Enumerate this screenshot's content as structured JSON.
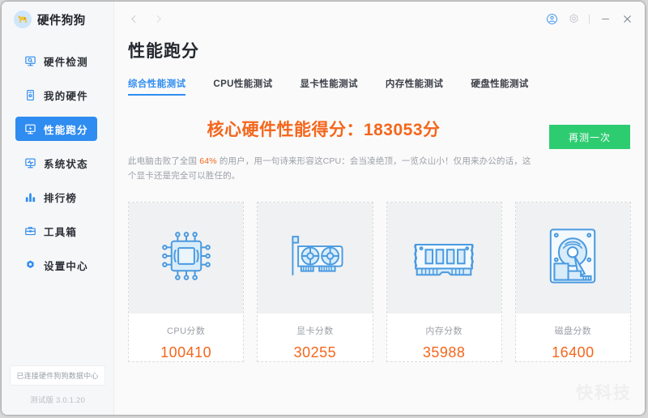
{
  "app": {
    "logo_icon": "dog-icon",
    "name": "硬件狗狗"
  },
  "sidebar": {
    "items": [
      {
        "label": "硬件检测",
        "icon": "monitor-search-icon",
        "active": false
      },
      {
        "label": "我的硬件",
        "icon": "desktop-tower-icon",
        "active": false
      },
      {
        "label": "性能跑分",
        "icon": "monitor-bolt-icon",
        "active": true
      },
      {
        "label": "系统状态",
        "icon": "monitor-pulse-icon",
        "active": false
      },
      {
        "label": "排行榜",
        "icon": "bar-chart-icon",
        "active": false
      },
      {
        "label": "工具箱",
        "icon": "toolbox-icon",
        "active": false
      },
      {
        "label": "设置中心",
        "icon": "gear-icon",
        "active": false
      }
    ],
    "status": "已连接硬件狗狗数据中心",
    "version": "测试版 3.0.1.20"
  },
  "titlebar": {
    "back_icon": "chevron-left-icon",
    "forward_icon": "chevron-right-icon",
    "account_icon": "user-avatar-icon",
    "settings_icon": "gear-icon",
    "minimize_icon": "minimize-icon",
    "close_icon": "close-icon"
  },
  "main": {
    "page_title": "性能跑分",
    "tabs": [
      {
        "label": "综合性能测试",
        "active": true
      },
      {
        "label": "CPU性能测试",
        "active": false
      },
      {
        "label": "显卡性能测试",
        "active": false
      },
      {
        "label": "内存性能测试",
        "active": false
      },
      {
        "label": "硬盘性能测试",
        "active": false
      }
    ],
    "score_headline": "核心硬件性能得分：183053分",
    "score_total": "183053",
    "desc_before": "此电脑击败了全国 ",
    "desc_percent": "64%",
    "desc_after": " 的用户，用一句诗来形容这CPU：会当凌绝顶，一览众山小！仅用来办公的话，这个显卡还是完全可以胜任的。",
    "retest_label": "再测一次",
    "cards": [
      {
        "icon": "cpu-chip-icon",
        "label": "CPU分数",
        "value": "100410"
      },
      {
        "icon": "graphics-card-icon",
        "label": "显卡分数",
        "value": "30255"
      },
      {
        "icon": "memory-ram-icon",
        "label": "内存分数",
        "value": "35988"
      },
      {
        "icon": "hard-disk-icon",
        "label": "磁盘分数",
        "value": "16400"
      }
    ],
    "watermark": "快科技"
  },
  "colors": {
    "accent_blue": "#2f8cf0",
    "score_orange": "#f4661b",
    "button_green": "#2ecc71",
    "icon_blue": "#5aa9e8"
  }
}
